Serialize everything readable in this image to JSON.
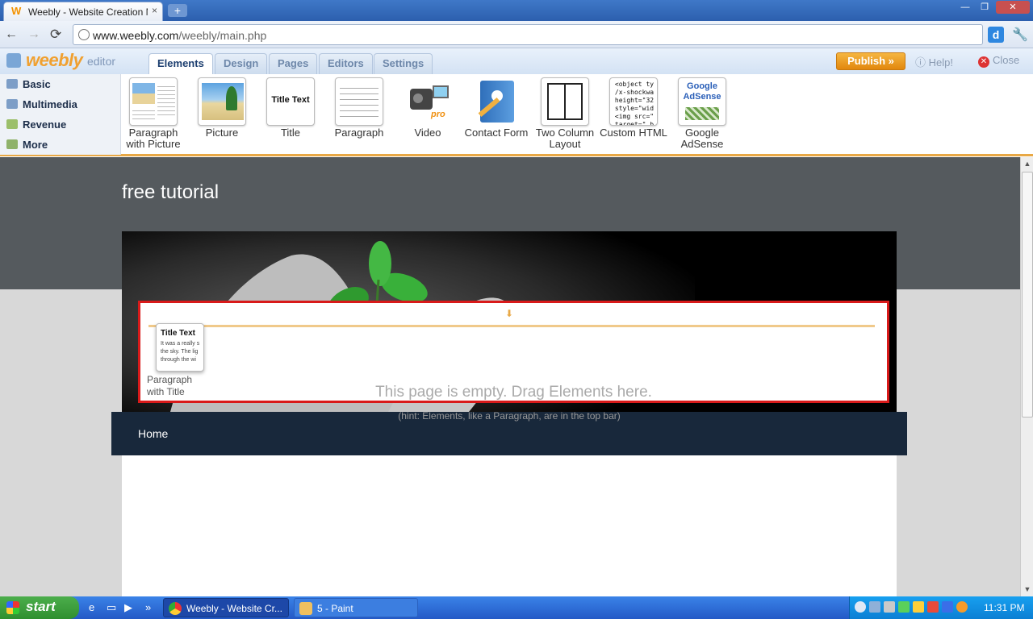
{
  "browser": {
    "tab_title": "Weebly - Website Creation Ma",
    "tab_close": "×",
    "new_tab": "+",
    "url_host": "www.weebly.com",
    "url_path": "/weebly/main.php",
    "window_controls": {
      "minimize": "—",
      "maximize": "❐",
      "close": "✕"
    }
  },
  "editor": {
    "logo_text": "weebly",
    "logo_sub": "editor",
    "tabs": [
      {
        "label": "Elements",
        "active": true
      },
      {
        "label": "Design"
      },
      {
        "label": "Pages"
      },
      {
        "label": "Editors"
      },
      {
        "label": "Settings"
      }
    ],
    "publish_label": "Publish »",
    "help_label": "Help!",
    "close_label": "Close",
    "categories": [
      {
        "label": "Basic"
      },
      {
        "label": "Multimedia"
      },
      {
        "label": "Revenue"
      },
      {
        "label": "More"
      }
    ],
    "elements": [
      {
        "label": "Paragraph with Picture",
        "icon": "paragraph-picture-icon"
      },
      {
        "label": "Picture",
        "icon": "picture-icon"
      },
      {
        "label": "Title",
        "icon": "title-icon",
        "thumb_text": "Title Text"
      },
      {
        "label": "Paragraph",
        "icon": "paragraph-icon"
      },
      {
        "label": "Video",
        "icon": "video-camera-icon"
      },
      {
        "label": "Contact Form",
        "icon": "contact-form-icon"
      },
      {
        "label": "Two Column Layout",
        "icon": "two-column-icon"
      },
      {
        "label": "Custom HTML",
        "icon": "custom-html-icon",
        "thumb_text": "<object ty /x-shockwa height=\"32 style=\"wid <img src=\" target=\"_b"
      },
      {
        "label": "Google AdSense",
        "icon": "adsense-icon",
        "thumb_text": "Google AdSense"
      }
    ]
  },
  "site": {
    "title": "free tutorial",
    "nav_home": "Home",
    "drag_thumb_title": "Title Text",
    "drag_thumb_text": "It was a really s the sky. The lig through the wi",
    "drag_label": "Paragraph with Title",
    "empty_message": "This page is empty. Drag Elements here.",
    "hint": "(hint: Elements, like a Paragraph, are in the top bar)"
  },
  "taskbar": {
    "start_label": "start",
    "tasks": [
      {
        "label": "Weebly - Website Cr..."
      },
      {
        "label": "5 - Paint"
      }
    ],
    "clock": "11:31 PM"
  }
}
